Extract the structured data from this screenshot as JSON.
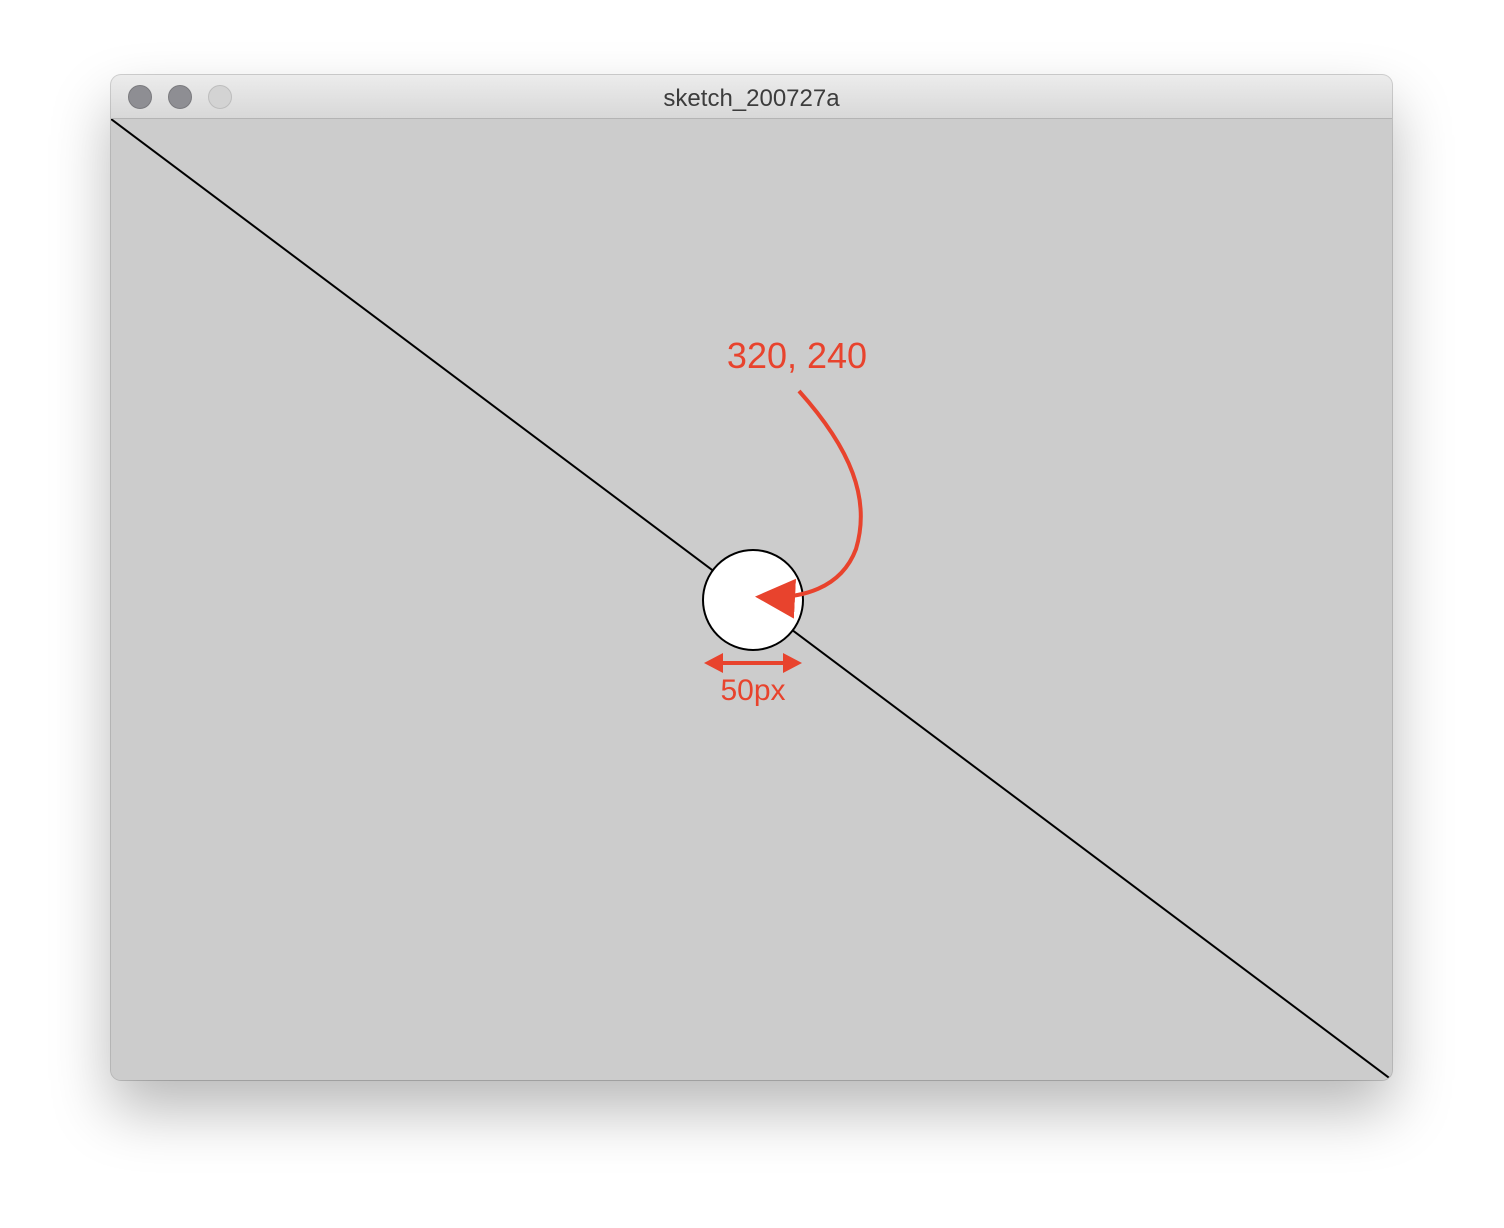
{
  "window": {
    "title": "sketch_200727a",
    "background_color": "#cccccc"
  },
  "traffic_lights": [
    {
      "name": "close",
      "state": "inactive"
    },
    {
      "name": "minimize",
      "state": "inactive"
    },
    {
      "name": "zoom",
      "state": "disabled"
    }
  ],
  "annotations": {
    "center_label": "320, 240",
    "diameter_label": "50px",
    "color": "#e8432d"
  },
  "sketch": {
    "shapes": [
      "line",
      "circle"
    ],
    "circle_fill": "#ffffff",
    "stroke_color": "#000000"
  }
}
